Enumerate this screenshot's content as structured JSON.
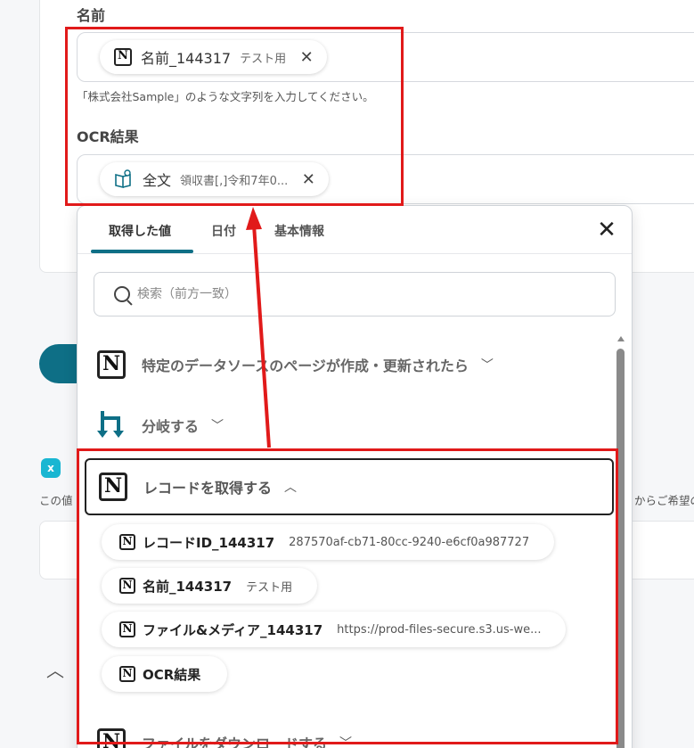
{
  "form": {
    "name_label": "名前",
    "name_chip": {
      "label": "名前_144317",
      "sub": "テスト用"
    },
    "name_hint": "「株式会社Sample」のような文字列を入力してください。",
    "ocr_label": "OCR結果",
    "ocr_chip": {
      "label": "全文",
      "sub": "領収書[,]令和7年0..."
    }
  },
  "background": {
    "badge": "x",
    "text_left": "この値",
    "text_right": "からご希望の"
  },
  "popup": {
    "tabs": [
      {
        "label": "取得した値"
      },
      {
        "label": "日付"
      },
      {
        "label": "基本情報"
      }
    ],
    "close_glyph": "✕",
    "search_placeholder": "検索（前方一致）",
    "sections": {
      "trigger": "特定のデータソースのページが作成・更新されたら",
      "branch": "分岐する",
      "record": "レコードを取得する",
      "download": "ファイルをダウンロードする"
    },
    "values": [
      {
        "label": "レコードID_144317",
        "sub": "287570af-cb71-80cc-9240-e6cf0a987727"
      },
      {
        "label": "名前_144317",
        "sub": "テスト用"
      },
      {
        "label": "ファイル&メディア_144317",
        "sub": "https://prod-files-secure.s3.us-we..."
      },
      {
        "label": "OCR結果",
        "sub": ""
      }
    ]
  },
  "colors": {
    "accent": "#0e6f86",
    "annotation": "#e11a1a"
  }
}
